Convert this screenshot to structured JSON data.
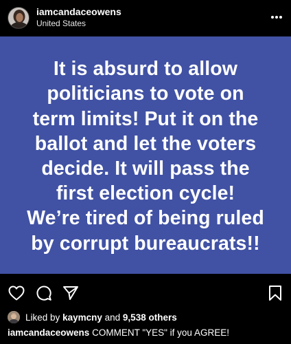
{
  "header": {
    "username": "iamcandaceowens",
    "location": "United States",
    "more_icon": "ellipsis-icon"
  },
  "post": {
    "background_color": "#4152a4",
    "text": "It is absurd to allow\npoliticians to vote on\nterm limits!  Put it on the\nballot and let the voters\ndecide.  It will pass the\nfirst election cycle!\nWe’re tired of being ruled\nby corrupt bureaucrats!!"
  },
  "actions": {
    "like_icon": "heart-icon",
    "comment_icon": "comment-bubble-icon",
    "share_icon": "paper-plane-icon",
    "save_icon": "bookmark-icon"
  },
  "likes": {
    "prefix": "Liked by",
    "user": "kaymcny",
    "conjunction": "and",
    "others": "9,538 others"
  },
  "caption": {
    "username": "iamcandaceowens",
    "text": "COMMENT \"YES\" if you AGREE!"
  }
}
